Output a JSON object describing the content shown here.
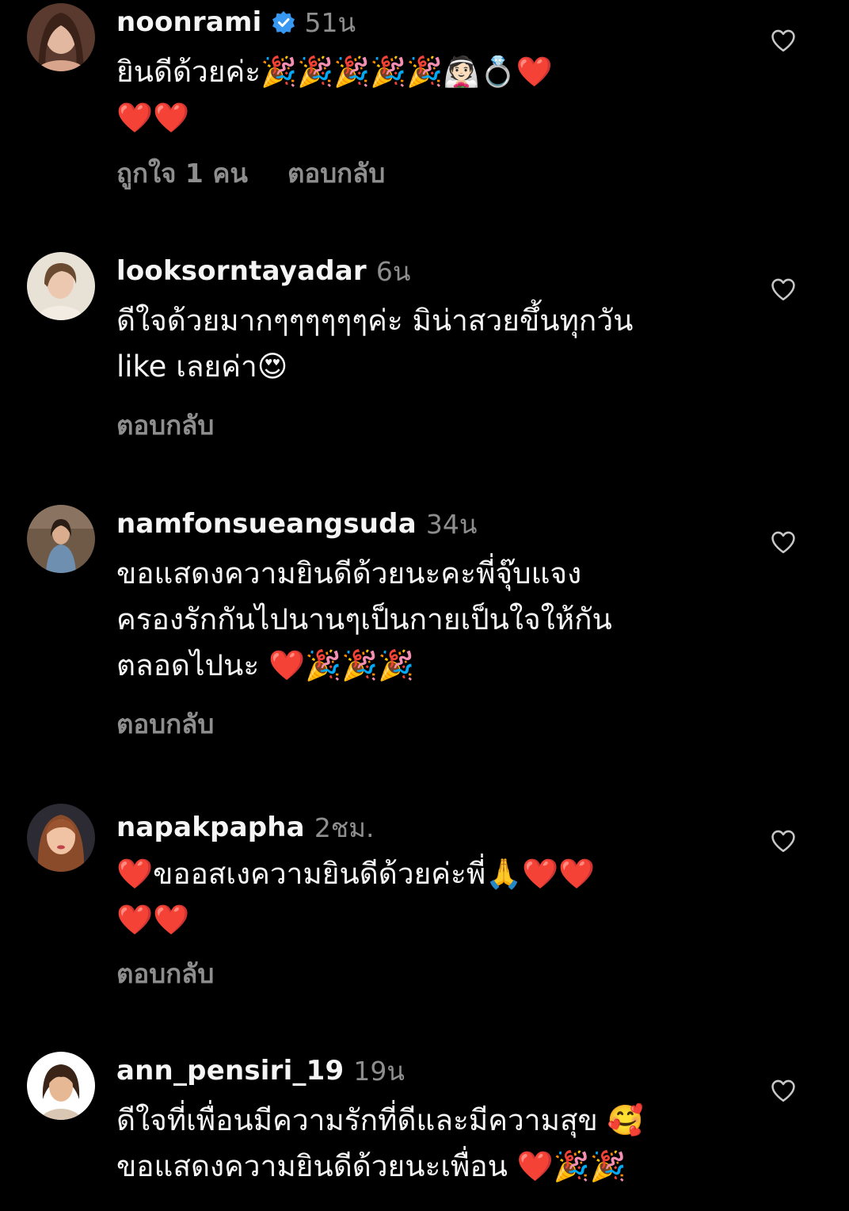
{
  "colors": {
    "background": "#000000",
    "text": "#f5f5f5",
    "secondary": "#8e8e8e",
    "verified": "#3897f0"
  },
  "comments": [
    {
      "username": "noonrami",
      "verified": true,
      "time": "51น",
      "text": "ยินดีด้วยค่ะ🎉🎉🎉🎉🎉👰🏻💍❤️\n❤️❤️",
      "likes": "ถูกใจ 1 คน",
      "reply": "ตอบกลับ",
      "like_icon": "heart-outline-icon"
    },
    {
      "username": "looksorntayadar",
      "verified": false,
      "time": "6น",
      "text": "ดีใจด้วยมากๆๆๆๆๆๆค่ะ มิน่าสวยขึ้นทุกวัน\nlike เลยค่า😍",
      "reply": "ตอบกลับ",
      "like_icon": "heart-outline-icon"
    },
    {
      "username": "namfonsueangsuda",
      "verified": false,
      "time": "34น",
      "text": "ขอแสดงความยินดีด้วยนะคะพี่จุ๊บแจง\nครองรักกันไปนานๆเป็นกายเป็นใจให้กัน\nตลอดไปนะ ❤️🎉🎉🎉",
      "reply": "ตอบกลับ",
      "like_icon": "heart-outline-icon"
    },
    {
      "username": "napakpapha",
      "verified": false,
      "time": "2ชม.",
      "text": "❤️ขออสเงความยินดีด้วยค่ะพี่🙏❤️❤️\n❤️❤️",
      "reply": "ตอบกลับ",
      "like_icon": "heart-outline-icon"
    },
    {
      "username": "ann_pensiri_19",
      "verified": false,
      "time": "19น",
      "text": "ดีใจที่เพื่อนมีความรักที่ดีและมีความสุข 🥰\nขอแสดงความยินดีด้วยนะเพื่อน ❤️🎉🎉",
      "like_icon": "heart-outline-icon"
    }
  ]
}
